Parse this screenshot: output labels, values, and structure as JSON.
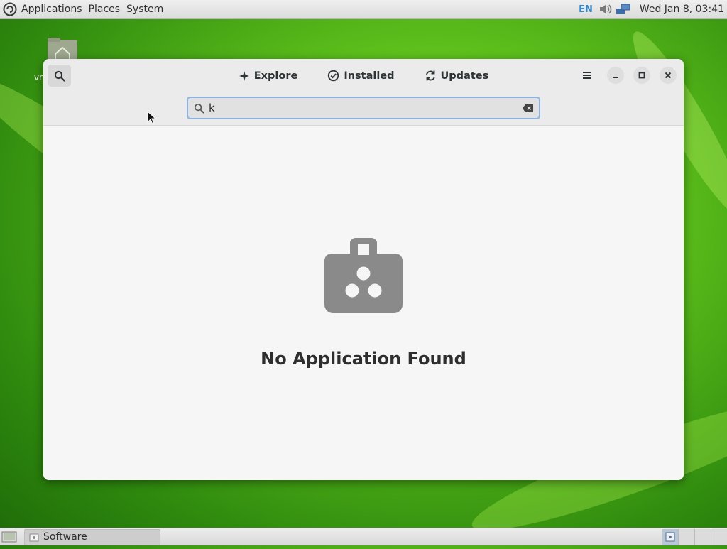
{
  "top_panel": {
    "menus": [
      "Applications",
      "Places",
      "System"
    ],
    "keyboard_layout": "EN",
    "clock": "Wed Jan 8, 03:41"
  },
  "desktop": {
    "home_icon_label": "vr"
  },
  "window": {
    "tabs": [
      {
        "label": "Explore",
        "icon": "sparkle-icon"
      },
      {
        "label": "Installed",
        "icon": "check-circle-icon"
      },
      {
        "label": "Updates",
        "icon": "refresh-icon"
      }
    ],
    "search": {
      "value": "k"
    },
    "empty_state": {
      "icon": "shopping-bag-icon",
      "title": "No Application Found"
    }
  },
  "taskbar": {
    "task_label": "Software"
  },
  "colors": {
    "focus_border": "#8cb3e0",
    "panel_bg": "#e4e4e4",
    "window_bg": "#f6f6f6",
    "icon_gray": "#8a8a8a"
  }
}
